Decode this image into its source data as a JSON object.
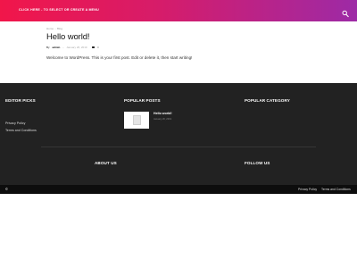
{
  "header": {
    "menu_link": "CLICK HERE - TO SELECT OR CREATE A MENU",
    "search_icon": "search-icon",
    "gradient_colors": [
      "#f1164a",
      "#9d2aa6"
    ]
  },
  "post": {
    "breadcrumb": [
      "Home",
      "Blog"
    ],
    "title": "Hello world!",
    "meta": {
      "by_label": "By",
      "author": "admin",
      "separator": "-",
      "date": "January 26, 2019",
      "comments": "0"
    },
    "body": "Welcome to WordPress. This is your first post. Edit or delete it, then start writing!"
  },
  "footer": {
    "background": "#222222",
    "editor_picks": {
      "title": "EDITOR PICKS",
      "links": [
        "Privacy Policy",
        "Terms and Conditions"
      ]
    },
    "popular_posts": {
      "title": "POPULAR POSTS",
      "item": {
        "title": "Hello world!",
        "date": "January 26, 2019"
      }
    },
    "popular_category": {
      "title": "POPULAR CATEGORY"
    },
    "about_us": {
      "title": "ABOUT US"
    },
    "follow_us": {
      "title": "FOLLOW US"
    }
  },
  "subfooter": {
    "copyright": "©",
    "links": [
      "Privacy Policy",
      "Terms and Conditions"
    ]
  }
}
